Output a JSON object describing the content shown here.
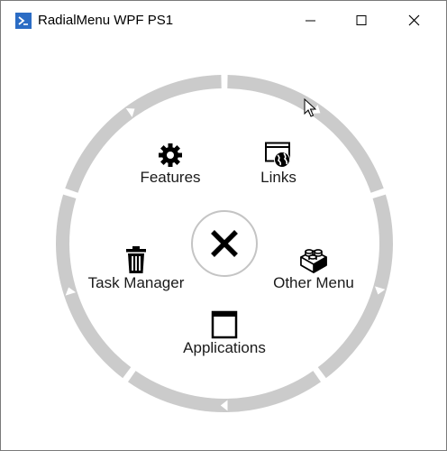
{
  "window": {
    "title": "RadialMenu WPF PS1",
    "icon": "powershell-icon",
    "controls": [
      "minimize-icon",
      "maximize-icon",
      "close-icon"
    ]
  },
  "menu": {
    "center_button_icon": "close-x-icon",
    "ring_color": "#cbcbcb",
    "items": [
      {
        "label": "Features",
        "icon": "gear-icon"
      },
      {
        "label": "Links",
        "icon": "web-globe-icon"
      },
      {
        "label": "Task Manager",
        "icon": "trash-icon"
      },
      {
        "label": "Other Menu",
        "icon": "lego-brick-icon"
      },
      {
        "label": "Applications",
        "icon": "window-icon"
      }
    ],
    "sub_menu_arrows": [
      "arrow-right-icon",
      "arrow-right-icon",
      "arrow-down-icon",
      "arrow-left-icon",
      "arrow-left-icon"
    ]
  }
}
